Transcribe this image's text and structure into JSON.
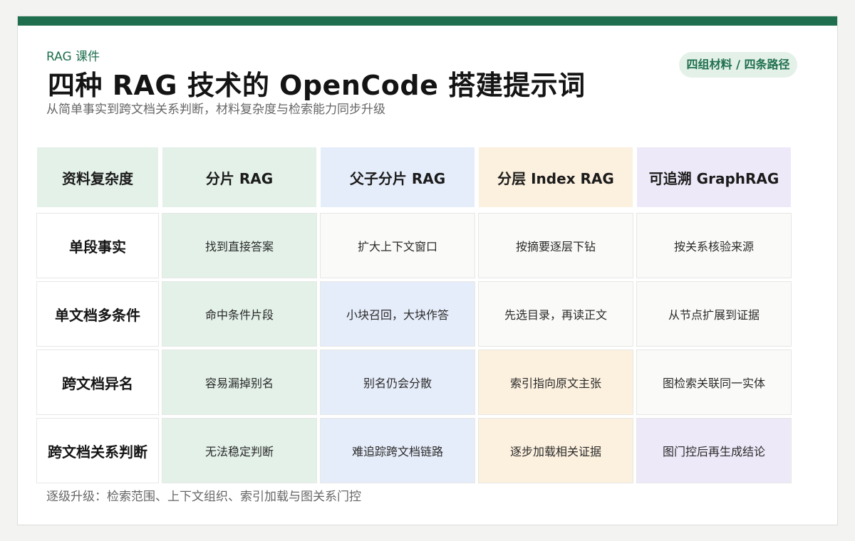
{
  "header": {
    "kicker": "RAG 课件",
    "title": "四种 RAG 技术的 OpenCode 搭建提示词",
    "subtitle": "从简单事实到跨文档关系判断，材料复杂度与检索能力同步升级",
    "badge": "四组材料 / 四条路径"
  },
  "table": {
    "corner": "资料复杂度",
    "columns": [
      "分片 RAG",
      "父子分片 RAG",
      "分层 Index RAG",
      "可追溯 GraphRAG"
    ],
    "rows": [
      {
        "label": "单段事实",
        "cells": [
          "找到直接答案",
          "扩大上下文窗口",
          "按摘要逐层下钻",
          "按关系核验来源"
        ]
      },
      {
        "label": "单文档多条件",
        "cells": [
          "命中条件片段",
          "小块召回，大块作答",
          "先选目录，再读正文",
          "从节点扩展到证据"
        ]
      },
      {
        "label": "跨文档异名",
        "cells": [
          "容易漏掉别名",
          "别名仍会分散",
          "索引指向原文主张",
          "图检索关联同一实体"
        ]
      },
      {
        "label": "跨文档关系判断",
        "cells": [
          "无法稳定判断",
          "难追踪跨文档链路",
          "逐步加载相关证据",
          "图门控后再生成结论"
        ]
      }
    ]
  },
  "footer": "逐级升级：检索范围、上下文组织、索引加载与图关系门控",
  "colors": {
    "accent": "#1f6f4e",
    "col_green": "#e3f1e8",
    "col_blue": "#e6edfa",
    "col_orange": "#fcf0de",
    "col_purple": "#eee9f8",
    "neutral": "#fafaf8"
  }
}
